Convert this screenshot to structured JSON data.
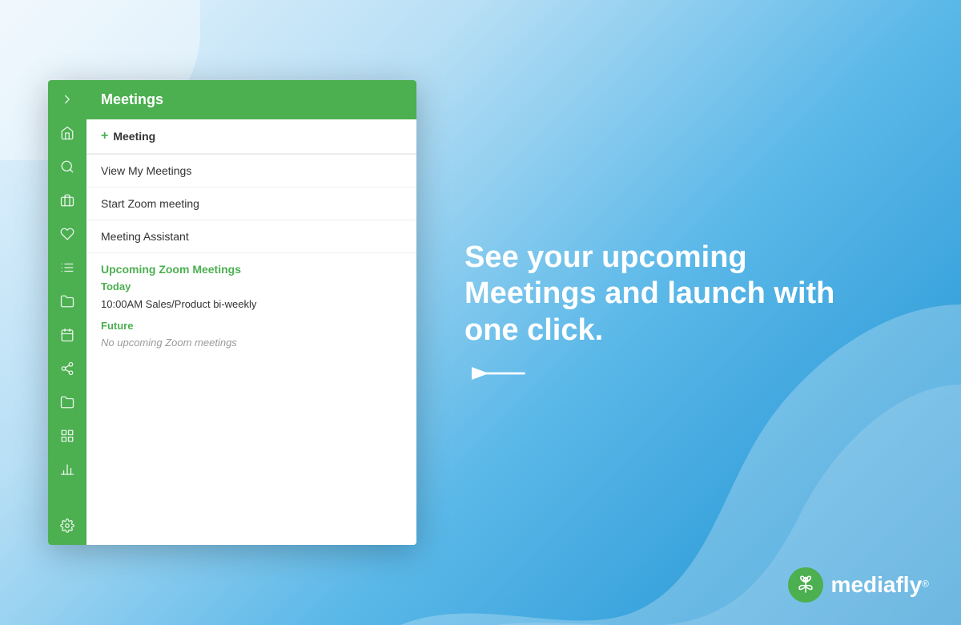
{
  "background": {
    "gradient_start": "#d0eaf8",
    "gradient_end": "#1a8fd1"
  },
  "sidebar": {
    "icons": [
      {
        "name": "arrow-right-icon",
        "label": "expand"
      },
      {
        "name": "home-icon",
        "label": "home"
      },
      {
        "name": "search-icon",
        "label": "search"
      },
      {
        "name": "briefcase-icon",
        "label": "briefcase"
      },
      {
        "name": "heart-icon",
        "label": "favorites"
      },
      {
        "name": "list-icon",
        "label": "list"
      },
      {
        "name": "folder-icon",
        "label": "folder"
      },
      {
        "name": "calendar-icon",
        "label": "calendar"
      },
      {
        "name": "share-icon",
        "label": "share"
      },
      {
        "name": "folder2-icon",
        "label": "folder2"
      },
      {
        "name": "grid-icon",
        "label": "grid"
      },
      {
        "name": "chart-icon",
        "label": "chart"
      },
      {
        "name": "settings-icon",
        "label": "settings"
      }
    ]
  },
  "panel": {
    "header": "Meetings",
    "menu_items": [
      {
        "label": "Meeting",
        "type": "add",
        "id": "add-meeting"
      },
      {
        "label": "View My Meetings",
        "type": "link",
        "id": "view-meetings"
      },
      {
        "label": "Start Zoom meeting",
        "type": "link",
        "id": "start-zoom"
      },
      {
        "label": "Meeting Assistant",
        "type": "link",
        "id": "meeting-assistant"
      }
    ],
    "upcoming_section": {
      "title": "Upcoming Zoom Meetings",
      "today_label": "Today",
      "meetings_today": [
        {
          "time": "10:00AM",
          "title": "Sales/Product bi-weekly"
        }
      ],
      "future_label": "Future",
      "no_future_text": "No upcoming Zoom meetings"
    }
  },
  "promo": {
    "headline": "See your upcoming Meetings and launch with one click."
  },
  "mediafly": {
    "name": "mediafly",
    "registered": "®"
  }
}
